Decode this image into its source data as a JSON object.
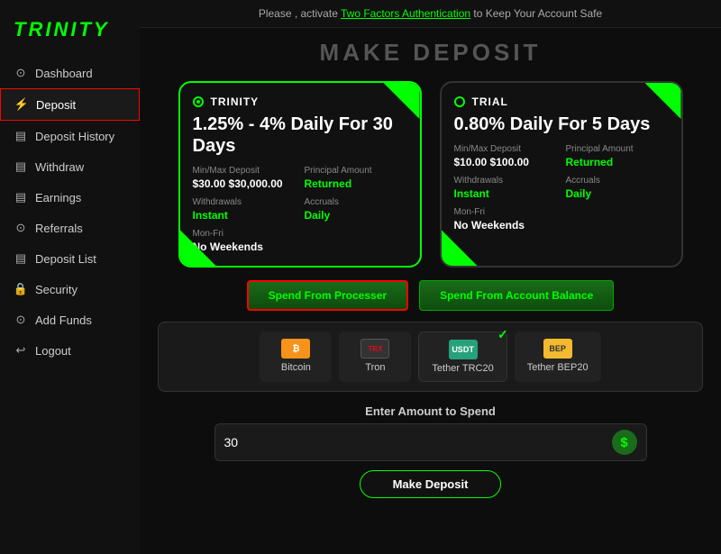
{
  "sidebar": {
    "logo": "TRINITY",
    "items": [
      {
        "id": "dashboard",
        "label": "Dashboard",
        "icon": "⊙"
      },
      {
        "id": "deposit",
        "label": "Deposit",
        "icon": "⚡",
        "active": true
      },
      {
        "id": "deposit-history",
        "label": "Deposit History",
        "icon": "▤"
      },
      {
        "id": "withdraw",
        "label": "Withdraw",
        "icon": "▤"
      },
      {
        "id": "earnings",
        "label": "Earnings",
        "icon": "▤"
      },
      {
        "id": "referrals",
        "label": "Referrals",
        "icon": "⊙"
      },
      {
        "id": "deposit-list",
        "label": "Deposit List",
        "icon": "▤"
      },
      {
        "id": "security",
        "label": "Security",
        "icon": "🔒"
      },
      {
        "id": "add-funds",
        "label": "Add Funds",
        "icon": "⊙"
      },
      {
        "id": "logout",
        "label": "Logout",
        "icon": "↩"
      }
    ]
  },
  "topbar": {
    "text": "Please , activate ",
    "link": "Two Factors Authentication",
    "suffix": " to Keep Your Account Safe"
  },
  "page": {
    "title": "MAKE DEPOSIT"
  },
  "plans": [
    {
      "id": "trinity",
      "name": "TRINITY",
      "rate": "1.25% - 4% Daily For 30 Days",
      "selected": true,
      "minDeposit": "$30.00",
      "maxDeposit": "$30,000.00",
      "principal": "Returned",
      "withdrawals": "Instant",
      "accruals": "Daily",
      "schedule": "Mon-Fri",
      "note": "No Weekends"
    },
    {
      "id": "trial",
      "name": "TRIAL",
      "rate": "0.80% Daily For 5 Days",
      "selected": false,
      "minDeposit": "$10.00",
      "maxDeposit": "$100.00",
      "principal": "Returned",
      "withdrawals": "Instant",
      "accruals": "Daily",
      "schedule": "Mon-Fri",
      "note": "No Weekends"
    }
  ],
  "buttons": {
    "processor": "Spend From Processer",
    "account": "Spend From Account Balance"
  },
  "crypto": [
    {
      "id": "btc",
      "label": "Bitcoin",
      "icon": "BTC",
      "type": "btc",
      "selected": false
    },
    {
      "id": "trx",
      "label": "Tron",
      "icon": "TRX",
      "type": "trx",
      "selected": false
    },
    {
      "id": "usdt-trc20",
      "label": "Tether TRC20",
      "icon": "USDT",
      "type": "usdt",
      "selected": true
    },
    {
      "id": "usdt-bep20",
      "label": "Tether BEP20",
      "icon": "BEP20",
      "type": "bep",
      "selected": false
    }
  ],
  "amount": {
    "label": "Enter Amount to Spend",
    "value": "30",
    "placeholder": "30",
    "currency_symbol": "$"
  },
  "deposit_button": "Make Deposit"
}
